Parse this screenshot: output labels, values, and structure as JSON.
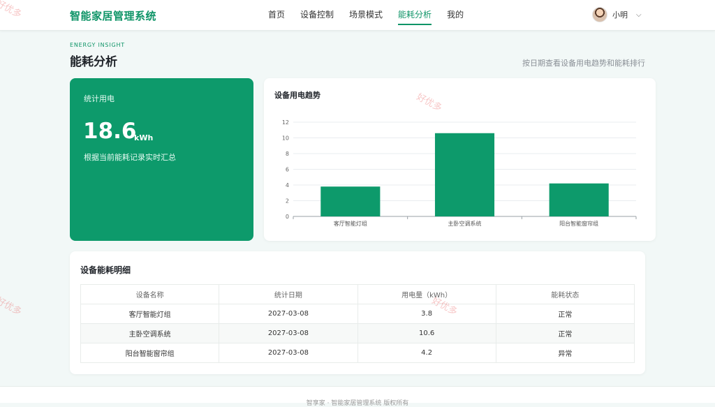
{
  "header": {
    "brand": "智能家居管理系统",
    "nav": [
      {
        "label": "首页",
        "active": false
      },
      {
        "label": "设备控制",
        "active": false
      },
      {
        "label": "场景模式",
        "active": false
      },
      {
        "label": "能耗分析",
        "active": true
      },
      {
        "label": "我的",
        "active": false
      }
    ],
    "user": {
      "name": "小明"
    }
  },
  "page": {
    "kicker": "ENERGY INSIGHT",
    "title": "能耗分析",
    "subtitle": "按日期查看设备用电趋势和能耗排行"
  },
  "stat": {
    "label": "统计用电",
    "value": "18.6",
    "unit": "kWh",
    "desc": "根据当前能耗记录实时汇总"
  },
  "chart_title": "设备用电趋势",
  "chart_data": {
    "type": "bar",
    "title": "设备用电趋势",
    "categories": [
      "客厅智能灯组",
      "主卧空调系统",
      "阳台智能窗帘组"
    ],
    "values": [
      3.8,
      10.6,
      4.2
    ],
    "ylim": [
      0,
      12
    ],
    "yticks": [
      0,
      2,
      4,
      6,
      8,
      10,
      12
    ],
    "grid": true,
    "color": "#0d9a6b"
  },
  "table": {
    "title": "设备能耗明细",
    "headers": [
      "设备名称",
      "统计日期",
      "用电量（kWh）",
      "能耗状态"
    ],
    "rows": [
      [
        "客厅智能灯组",
        "2027-03-08",
        "3.8",
        "正常"
      ],
      [
        "主卧空调系统",
        "2027-03-08",
        "10.6",
        "正常"
      ],
      [
        "阳台智能窗帘组",
        "2027-03-08",
        "4.2",
        "异常"
      ]
    ]
  },
  "footer": {
    "text": "智享家 · 智能家居管理系统 版权所有"
  },
  "watermark": "好优多",
  "colors": {
    "brand": "#0e9467",
    "accent": "#0d9a6b",
    "background": "#f2f8f7"
  }
}
